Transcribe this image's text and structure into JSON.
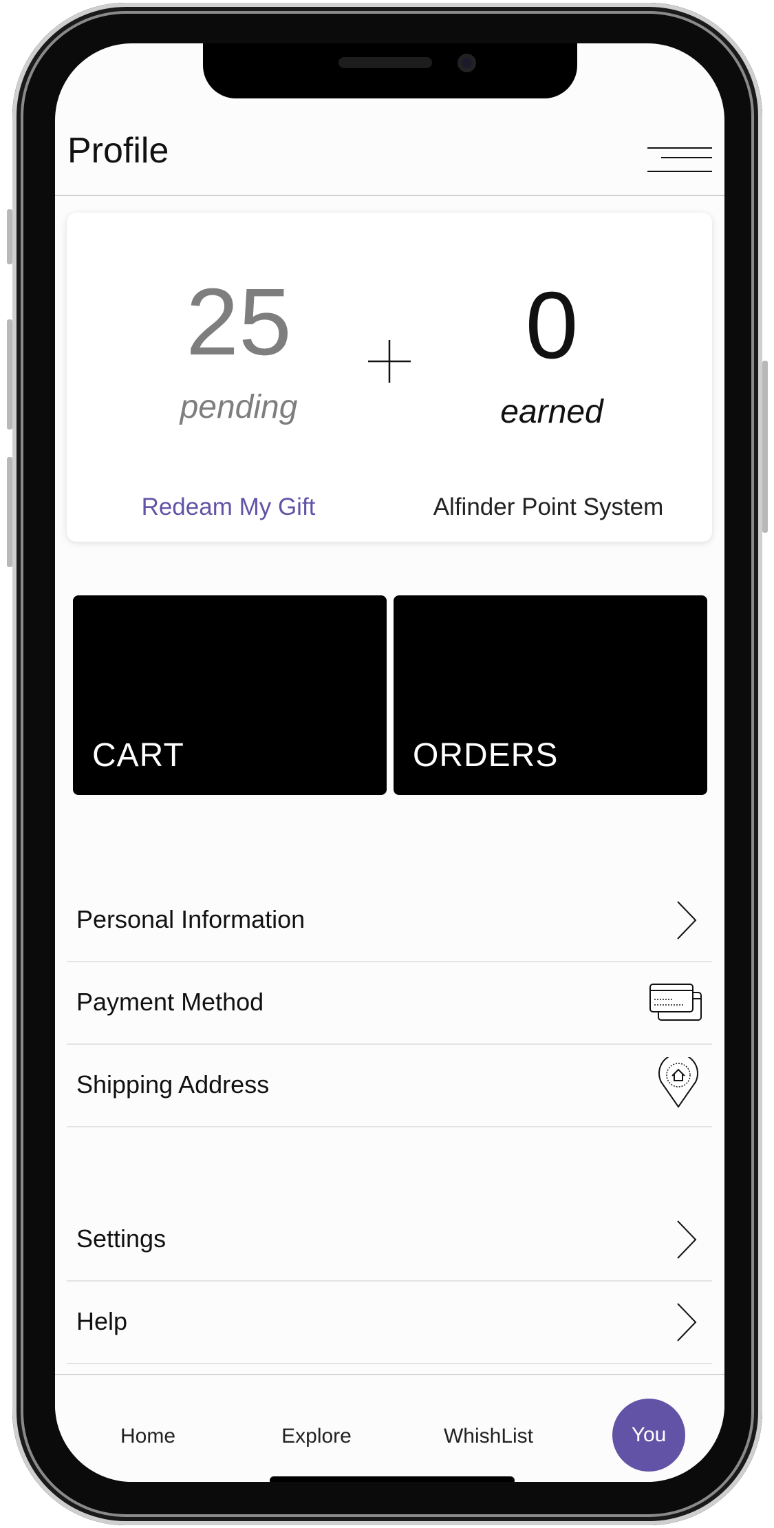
{
  "header": {
    "title": "Profile",
    "menu_icon": "hamburger-menu-icon"
  },
  "points": {
    "pending_value": "25",
    "pending_label": "pending",
    "operator": "+",
    "earned_value": "0",
    "earned_label": "earned",
    "redeem_link": "Redeam My Gift",
    "system_link": "Alfinder Point System"
  },
  "tiles": [
    {
      "label": "CART"
    },
    {
      "label": "ORDERS"
    }
  ],
  "account_list": [
    {
      "label": "Personal Information",
      "icon": "chevron-right-icon"
    },
    {
      "label": "Payment Method",
      "icon": "credit-cards-icon"
    },
    {
      "label": "Shipping Address",
      "icon": "home-location-pin-icon"
    }
  ],
  "support_list": [
    {
      "label": "Settings",
      "icon": "chevron-right-icon"
    },
    {
      "label": "Help",
      "icon": "chevron-right-icon"
    }
  ],
  "tabbar": {
    "items": [
      {
        "label": "Home"
      },
      {
        "label": "Explore"
      },
      {
        "label": "WhishList"
      },
      {
        "label": "You",
        "active": true
      }
    ]
  },
  "colors": {
    "accent": "#6353a6",
    "tile_bg": "#000000",
    "muted_text": "#7e7e7e"
  }
}
